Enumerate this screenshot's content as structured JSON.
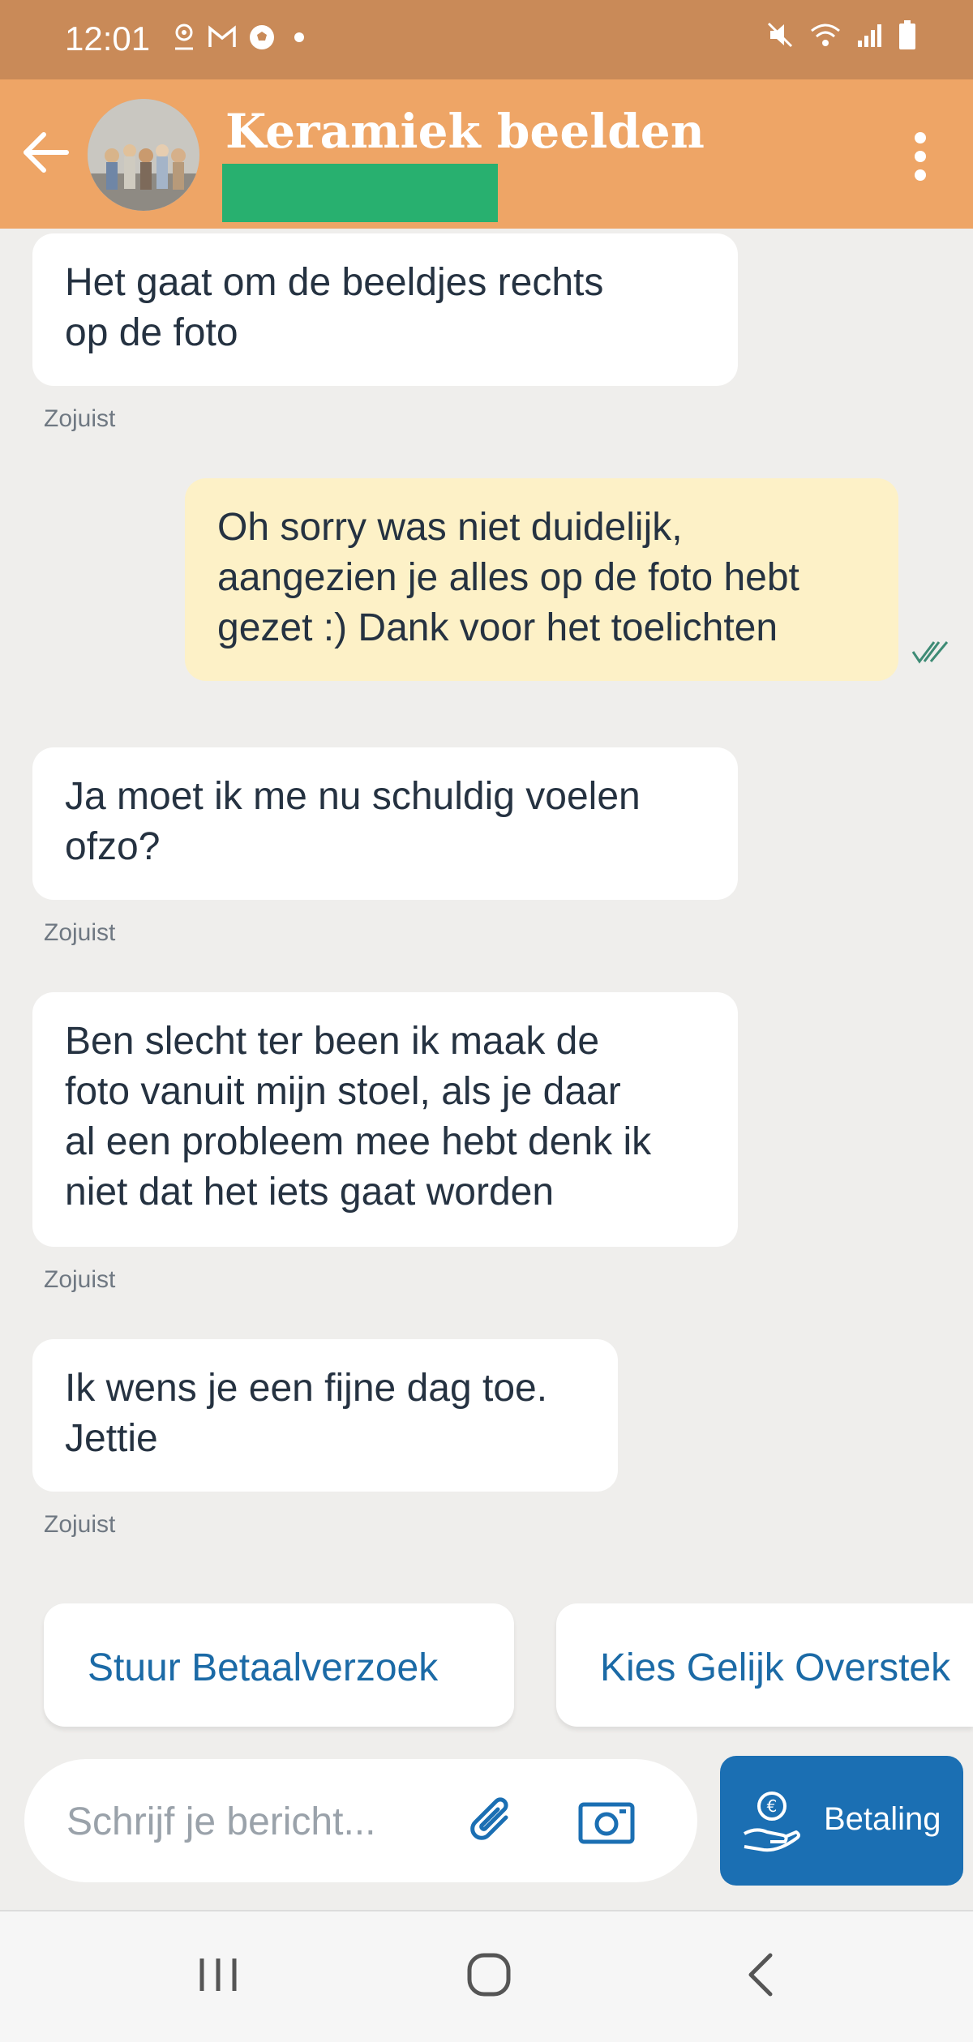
{
  "status_bar": {
    "time": "12:01",
    "left_icons": [
      "location-icon",
      "gmail-icon",
      "soccer-ball-icon",
      "dot-icon"
    ],
    "right_icons": [
      "mute-icon",
      "wifi-icon",
      "signal-icon",
      "battery-icon"
    ]
  },
  "header": {
    "title": "Keramiek beelden",
    "background": "#eea566",
    "redaction_color": "#28b06f"
  },
  "messages": [
    {
      "direction": "incoming",
      "text_lines": [
        "Het gaat om de beeldjes rechts",
        "op de foto"
      ],
      "timestamp": "Zojuist"
    },
    {
      "direction": "outgoing",
      "text_lines": [
        "Oh sorry was niet duidelijk,",
        "aangezien je alles op de foto hebt",
        "gezet :) Dank voor het toelichten"
      ],
      "status_icon": "double-check-icon"
    },
    {
      "direction": "incoming",
      "text_lines": [
        "Ja moet ik me nu schuldig voelen",
        "ofzo?"
      ],
      "timestamp": "Zojuist"
    },
    {
      "direction": "incoming",
      "text_lines": [
        "Ben slecht ter been ik maak de",
        "foto vanuit mijn stoel, als je daar",
        "al een probleem mee hebt denk ik",
        "niet dat het iets gaat worden"
      ],
      "timestamp": "Zojuist"
    },
    {
      "direction": "incoming",
      "text_lines": [
        "Ik wens je een fijne dag toe.",
        "Jettie"
      ],
      "timestamp": "Zojuist"
    }
  ],
  "quick_actions": [
    "Stuur Betaalverzoek",
    "Kies Gelijk Overstek"
  ],
  "composer": {
    "placeholder": "Schrijf je bericht...",
    "pay_button_label": "Betaling"
  },
  "colors": {
    "accent_blue": "#1b6fb3",
    "outgoing_bubble": "#fdf1c7",
    "incoming_bubble": "#ffffff",
    "background": "#efeeec"
  }
}
